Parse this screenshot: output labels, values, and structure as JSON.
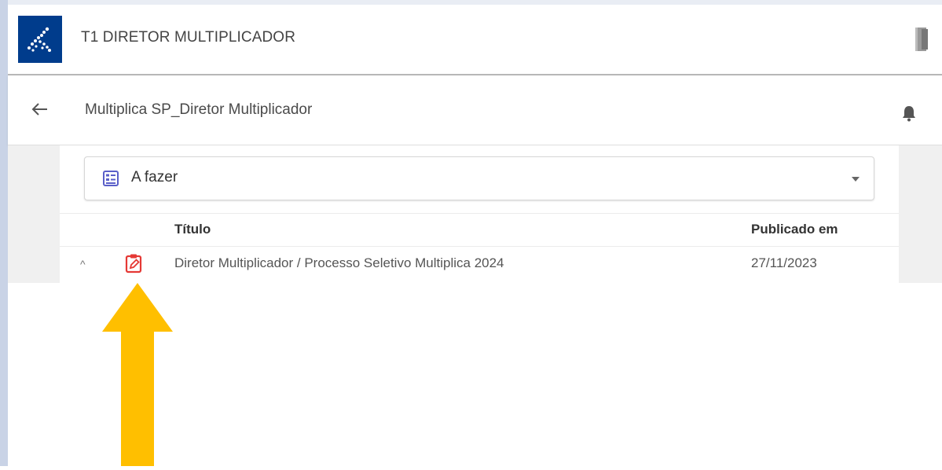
{
  "app": {
    "title": "T1 DIRETOR MULTIPLICADOR"
  },
  "header": {
    "class_title": "Multiplica SP_Diretor Multiplicador"
  },
  "filter": {
    "selected": "A fazer"
  },
  "table": {
    "columns": [
      "Título",
      "Publicado em"
    ],
    "rows": [
      {
        "title": "Diretor Multiplicador / Processo Seletivo Multiplica 2024",
        "published": "27/11/2023"
      }
    ]
  },
  "icons": {
    "logo": "constellation-logo-icon",
    "exit": "door-exit-icon",
    "back": "arrow-left-icon",
    "notifications": "bell-icon",
    "filter": "checklist-icon",
    "dropdown": "chevron-down-icon",
    "row_toggle": "chevron-up-icon",
    "task": "clipboard-edit-icon",
    "annotation": "up-arrow-icon"
  },
  "colors": {
    "brand": "#003c8c",
    "filter_icon": "#5a5fc9",
    "task_icon": "#e53935",
    "annotation_arrow": "#ffbf00",
    "side_rail": "#c9d3e6"
  }
}
